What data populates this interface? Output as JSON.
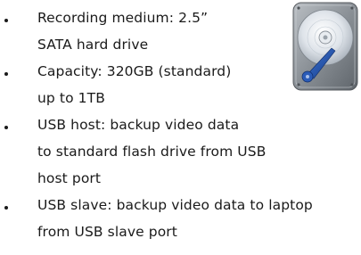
{
  "specs": [
    {
      "lines": [
        "Recording medium: 2.5”",
        "SATA hard drive"
      ]
    },
    {
      "lines": [
        "Capacity: 320GB (standard)",
        "up to 1TB"
      ]
    },
    {
      "lines": [
        "USB host: backup video data",
        "to standard flash drive from USB",
        "host port"
      ]
    },
    {
      "lines": [
        "USB slave: backup video data to laptop",
        "from USB slave port"
      ]
    }
  ],
  "icons": {
    "hard_drive": "hard-drive-icon"
  },
  "colors": {
    "text": "#1a1a1a",
    "drive_body": "#8a9096",
    "platter": "#dfe4ea",
    "arm": "#1e4fa8"
  }
}
